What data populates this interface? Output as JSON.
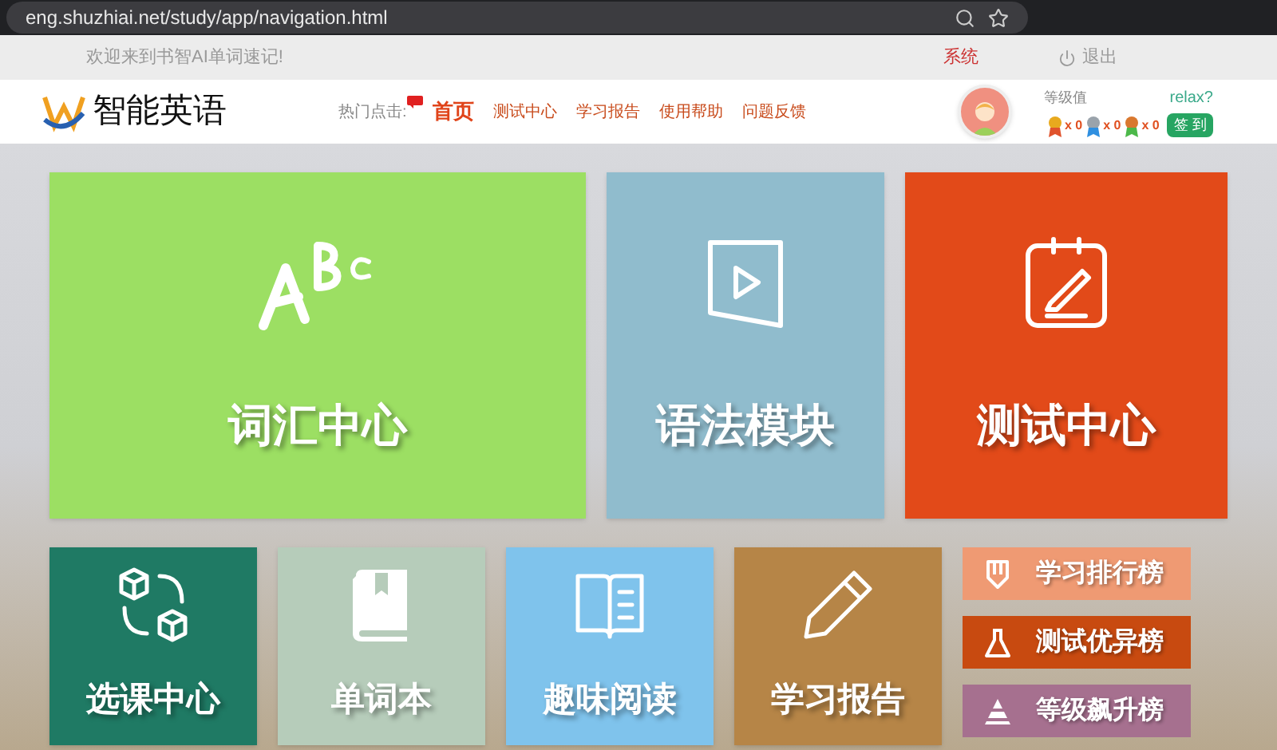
{
  "browser": {
    "url": "eng.shuzhiai.net/study/app/navigation.html"
  },
  "top_bar": {
    "welcome": "欢迎来到书智AI单词速记!",
    "system": "系统",
    "logout": "退出"
  },
  "header": {
    "logo": "智能英语",
    "hot_label": "热门点击:",
    "nav": [
      {
        "label": "首页",
        "selected": true
      },
      {
        "label": "测试中心",
        "selected": false
      },
      {
        "label": "学习报告",
        "selected": false
      },
      {
        "label": "使用帮助",
        "selected": false
      },
      {
        "label": "问题反馈",
        "selected": false
      }
    ],
    "user": {
      "level_label": "等级值",
      "relax": "relax?",
      "medals": [
        {
          "kind": "gold",
          "count": "x 0"
        },
        {
          "kind": "silver",
          "count": "x 0"
        },
        {
          "kind": "bronze",
          "count": "x 0"
        }
      ],
      "checkin": "签 到"
    }
  },
  "tiles": [
    {
      "kind": "abc",
      "label": "词汇中心",
      "color": "#9cdf63"
    },
    {
      "kind": "play",
      "label": "语法模块",
      "color": "#90bccd"
    },
    {
      "kind": "test",
      "label": "测试中心",
      "color": "#e24a19"
    }
  ],
  "small_tiles": [
    {
      "kind": "cubes",
      "label": "选课中心",
      "color": "#1f7a64"
    },
    {
      "kind": "book",
      "label": "单词本",
      "color": "#b6ccba"
    },
    {
      "kind": "reading",
      "label": "趣味阅读",
      "color": "#7fc3ec"
    },
    {
      "kind": "pen",
      "label": "学习报告",
      "color": "#b68547"
    }
  ],
  "rankings": [
    {
      "kind": "shield",
      "label": "学习排行榜",
      "color": "#ef9a73"
    },
    {
      "kind": "flask",
      "label": "测试优异榜",
      "color": "#c84a10"
    },
    {
      "kind": "pyramid",
      "label": "等级飙升榜",
      "color": "#a6708f"
    }
  ]
}
